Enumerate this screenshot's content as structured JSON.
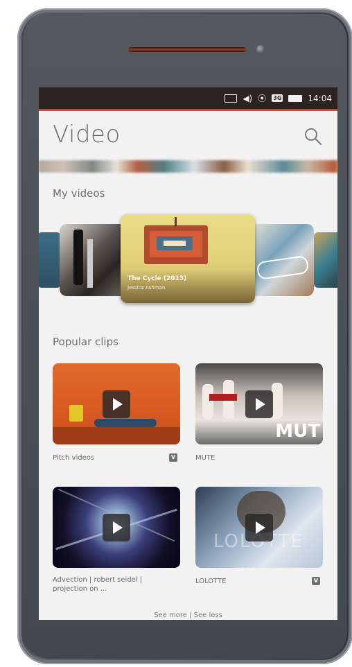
{
  "statusbar": {
    "time": "14:04",
    "icons": [
      "envelope-icon",
      "volume-icon",
      "wifi-icon",
      "3g-icon",
      "battery-icon"
    ],
    "network_badge": "3G",
    "accent_color": "#d0462a"
  },
  "header": {
    "title": "Video",
    "search_icon": "search-icon"
  },
  "sections": {
    "my_videos": "My videos",
    "popular_clips": "Popular clips"
  },
  "carousel": {
    "featured": {
      "title": "The Cycle (2013)",
      "author": "Jessica Ashman"
    }
  },
  "clips": [
    {
      "caption": "Pitch videos",
      "badge": "V",
      "play_icon": "play-icon"
    },
    {
      "caption": "MUTE",
      "overlay_text": "MUT",
      "play_icon": "play-icon"
    },
    {
      "caption": "Advection | robert seidel | projection on ...",
      "play_icon": "play-icon"
    },
    {
      "caption": "LOLOTTE",
      "badge": "V",
      "play_icon": "play-icon"
    }
  ],
  "footer": {
    "see_more": "See more",
    "see_less": "See less"
  }
}
